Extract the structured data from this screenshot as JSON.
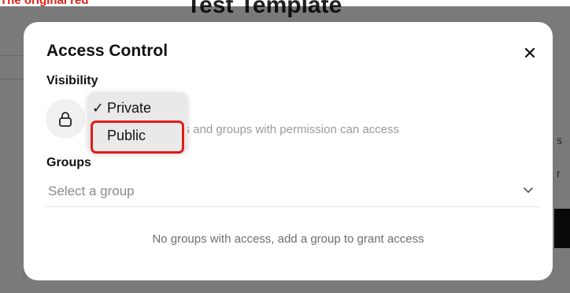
{
  "background": {
    "page_title": "Test Template",
    "annotation_label": "The original red"
  },
  "modal": {
    "title": "Access Control",
    "close_icon": "close-icon"
  },
  "visibility": {
    "label": "Visibility",
    "icon": "lock-icon",
    "description": "Only select users and groups with permission can access",
    "description_visible": "ers and groups with permission can access"
  },
  "dropdown": {
    "options": [
      {
        "label": "Private",
        "selected": true
      },
      {
        "label": "Public",
        "selected": false
      }
    ],
    "check_mark": "✓",
    "highlighted_option": "Public",
    "highlight_color": "#e21a1a"
  },
  "groups": {
    "label": "Groups",
    "placeholder": "Select a group",
    "chevron_icon": "chevron-down-icon",
    "empty_message": "No groups with access, add a group to grant access"
  },
  "colors": {
    "overlay": "rgba(0,0,0,0.52)",
    "modal_bg": "#ffffff",
    "annotation": "#e0201b"
  }
}
